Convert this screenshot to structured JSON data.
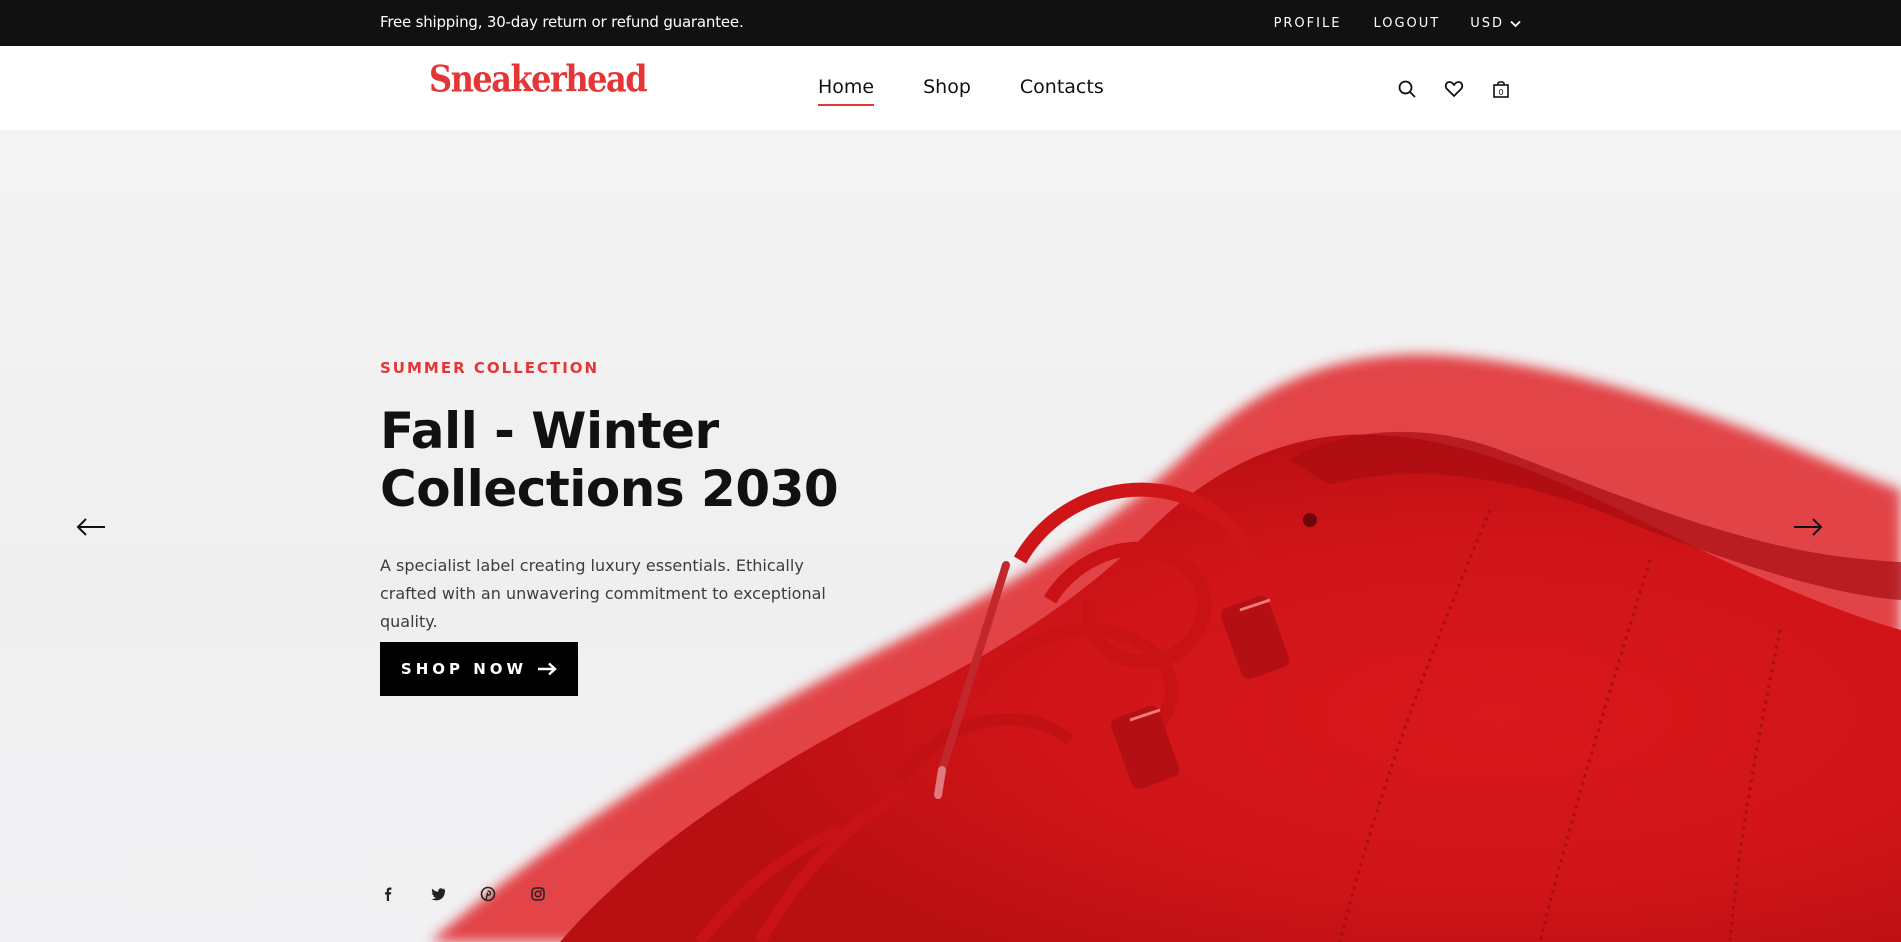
{
  "topbar": {
    "shipping_text": "Free shipping, 30-day return or refund guarantee.",
    "profile_label": "PROFILE",
    "logout_label": "LOGOUT",
    "currency_label": "USD"
  },
  "header": {
    "logo_text": "Sneakerhead",
    "nav": [
      {
        "label": "Home",
        "active": true
      },
      {
        "label": "Shop",
        "active": false
      },
      {
        "label": "Contacts",
        "active": false
      }
    ],
    "cart_count": "0",
    "icons": [
      "search-icon",
      "heart-icon",
      "shopping-bag-icon"
    ]
  },
  "hero": {
    "eyebrow": "SUMMER COLLECTION",
    "title": "Fall - Winter Collections 2030",
    "description": "A specialist label creating luxury essentials. Ethically crafted with an unwavering commitment to exceptional quality.",
    "button_label": "SHOP NOW",
    "arrow_icons": [
      "arrow-left-icon",
      "arrow-right-icon"
    ],
    "social_icons": [
      "facebook-icon",
      "twitter-icon",
      "pinterest-icon",
      "instagram-icon"
    ]
  },
  "colors": {
    "accent": "#e53637",
    "topbar_bg": "#111111",
    "button_bg": "#000000",
    "shoe_red": "#d3171b"
  }
}
